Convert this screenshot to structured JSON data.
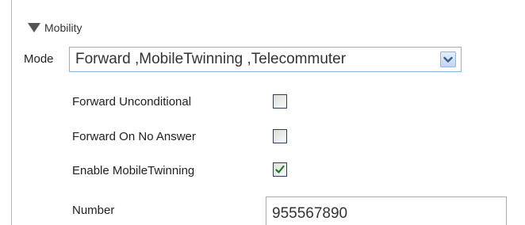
{
  "section": {
    "title": "Mobility",
    "icon": "triangle-down-icon"
  },
  "mode": {
    "label": "Mode",
    "selected": "Forward ,MobileTwinning ,Telecommuter",
    "dropdown_icon": "chevron-down-icon"
  },
  "options": [
    {
      "label": "Forward Unconditional",
      "checked": false
    },
    {
      "label": "Forward On  No Answer",
      "checked": false
    },
    {
      "label": "Enable  MobileTwinning",
      "checked": true
    }
  ],
  "number": {
    "label": "Number",
    "value": "955567890"
  },
  "colors": {
    "select_border": "#8db2d8",
    "check_mark": "#1e7a1e",
    "checkbox_border": "#2b3f56"
  }
}
